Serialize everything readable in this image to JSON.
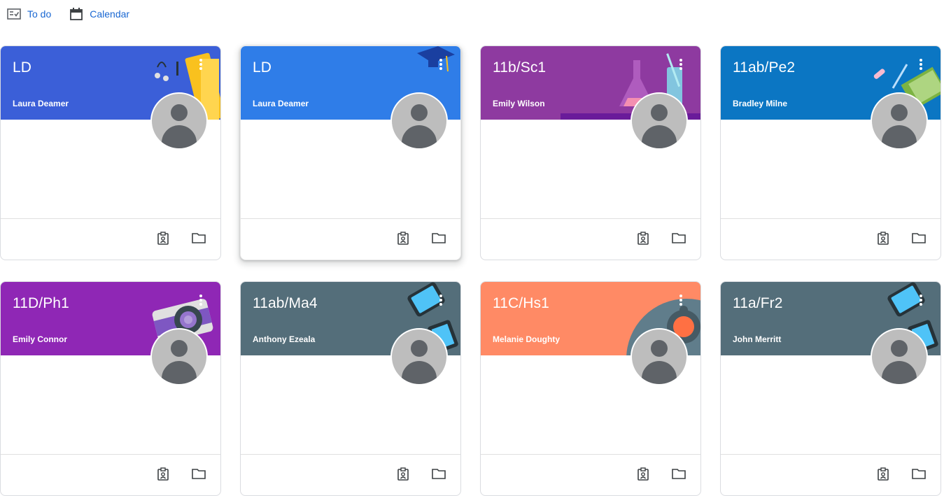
{
  "nav": {
    "todo_label": "To do",
    "calendar_label": "Calendar",
    "accent": "#1967d2"
  },
  "classes": [
    {
      "title": "LD",
      "teacher": "Laura Deamer",
      "color": "#3b5fd8",
      "theme": "headphones"
    },
    {
      "title": "LD",
      "teacher": "Laura Deamer",
      "color": "#2f7de8",
      "theme": "graduation"
    },
    {
      "title": "11b/Sc1",
      "teacher": "Emily Wilson",
      "color": "#8e3aa0",
      "theme": "science"
    },
    {
      "title": "11ab/Pe2",
      "teacher": "Bradley Milne",
      "color": "#0b76c3",
      "theme": "pencil"
    },
    {
      "title": "11D/Ph1",
      "teacher": "Emily Connor",
      "color": "#8f27b5",
      "theme": "camera"
    },
    {
      "title": "11ab/Ma4",
      "teacher": "Anthony Ezeala",
      "color": "#546e7a",
      "theme": "phone"
    },
    {
      "title": "11C/Hs1",
      "teacher": "Melanie Doughty",
      "color": "#ff8a65",
      "theme": "history"
    },
    {
      "title": "11a/Fr2",
      "teacher": "John Merritt",
      "color": "#546e7a",
      "theme": "phone"
    }
  ],
  "icons": {
    "todo": "checklist-icon",
    "calendar": "calendar-icon",
    "more": "more-vert-icon",
    "avatar": "avatar-placeholder",
    "assignment": "assignment-icon",
    "folder": "folder-icon"
  }
}
